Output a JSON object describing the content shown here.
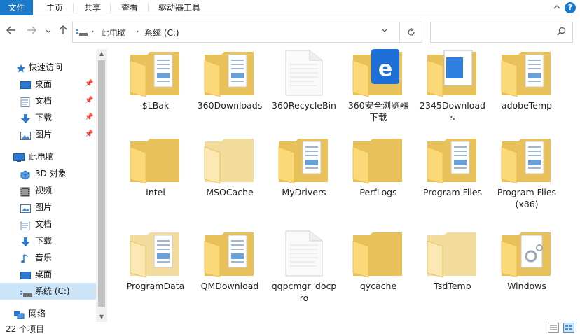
{
  "ribbon": {
    "tabs": [
      "文件",
      "主页",
      "共享",
      "查看",
      "驱动器工具"
    ],
    "collapse_icon": "chevron-up-icon",
    "help_icon": "help-icon",
    "help_label": "?"
  },
  "toolbar": {
    "back_icon": "arrow-left-icon",
    "forward_icon": "arrow-right-icon",
    "recent_icon": "chevron-down-icon",
    "up_icon": "arrow-up-icon",
    "breadcrumbs": [
      "此电脑",
      "系统 (C:)"
    ],
    "refresh_icon": "refresh-icon",
    "search_placeholder": ""
  },
  "sidebar": {
    "quick_access": {
      "label": "快速访问",
      "items": [
        {
          "label": "桌面",
          "icon": "desktop-icon",
          "pinned": true
        },
        {
          "label": "文档",
          "icon": "documents-icon",
          "pinned": true
        },
        {
          "label": "下载",
          "icon": "download-icon",
          "pinned": true
        },
        {
          "label": "图片",
          "icon": "pictures-icon",
          "pinned": true
        }
      ]
    },
    "this_pc": {
      "label": "此电脑",
      "items": [
        {
          "label": "3D 对象",
          "icon": "3d-objects-icon"
        },
        {
          "label": "视频",
          "icon": "video-icon"
        },
        {
          "label": "图片",
          "icon": "pictures-icon"
        },
        {
          "label": "文档",
          "icon": "documents-icon"
        },
        {
          "label": "下载",
          "icon": "download-icon"
        },
        {
          "label": "音乐",
          "icon": "music-icon"
        },
        {
          "label": "桌面",
          "icon": "desktop-icon"
        },
        {
          "label": "系统 (C:)",
          "icon": "drive-icon",
          "selected": true
        }
      ]
    },
    "network": {
      "label": "网络",
      "icon": "network-icon"
    }
  },
  "files": [
    {
      "name": "$LBak",
      "kind": "folder-docs"
    },
    {
      "name": "360Downloads",
      "kind": "folder-docs"
    },
    {
      "name": "360RecycleBin",
      "kind": "folder-white"
    },
    {
      "name": "360安全浏览器\n下载",
      "kind": "folder-app"
    },
    {
      "name": "2345Download\ns",
      "kind": "folder-window"
    },
    {
      "name": "adobeTemp",
      "kind": "folder-docs"
    },
    {
      "name": "Intel",
      "kind": "folder-empty"
    },
    {
      "name": "MSOCache",
      "kind": "folder-pale"
    },
    {
      "name": "MyDrivers",
      "kind": "folder-docs"
    },
    {
      "name": "PerfLogs",
      "kind": "folder-empty"
    },
    {
      "name": "Program Files",
      "kind": "folder-docs"
    },
    {
      "name": "Program Files\n(x86)",
      "kind": "folder-docs"
    },
    {
      "name": "ProgramData",
      "kind": "folder-docs-pale"
    },
    {
      "name": "QMDownload",
      "kind": "folder-docs"
    },
    {
      "name": "qqpcmgr_docp\nro",
      "kind": "folder-white"
    },
    {
      "name": "qycache",
      "kind": "folder-empty"
    },
    {
      "name": "TsdTemp",
      "kind": "folder-pale"
    },
    {
      "name": "Windows",
      "kind": "folder-gear"
    }
  ],
  "status": {
    "item_count": "22 个项目",
    "details_view_icon": "details-view-icon",
    "large_icons_view_icon": "large-icons-view-icon"
  },
  "colors": {
    "accent": "#1979ca",
    "folder_back": "#e8c15a",
    "folder_front": "#fcd978",
    "selection": "#cce4f7"
  }
}
